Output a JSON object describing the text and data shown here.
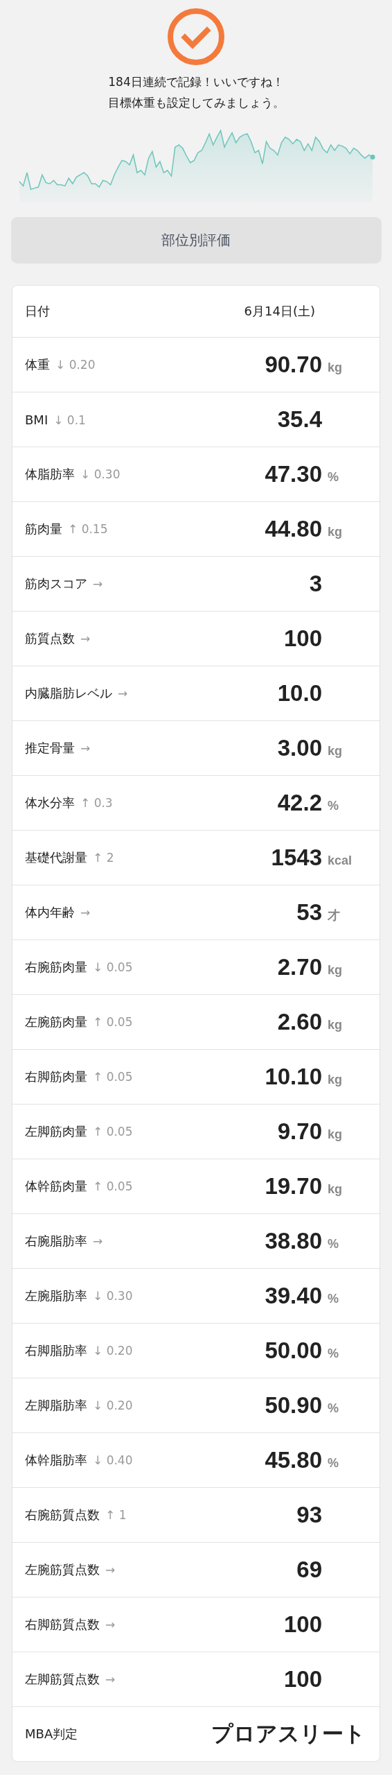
{
  "status": {
    "message_lines": [
      "184日連続で記録！いいですね！",
      "目標体重も設定してみましょう。"
    ]
  },
  "section_button": {
    "label": "部位別評価"
  },
  "table": {
    "rows": [
      {
        "kind": "date",
        "label": "日付",
        "value": "6月14日(土)"
      },
      {
        "kind": "number",
        "label": "体重",
        "change": "↓ 0.20",
        "value": "90.70",
        "unit": "kg"
      },
      {
        "kind": "number",
        "label": "BMI",
        "change": "↓ 0.1",
        "value": "35.4"
      },
      {
        "kind": "number",
        "label": "体脂肪率",
        "change": "↓ 0.30",
        "value": "47.30",
        "unit": "%"
      },
      {
        "kind": "number",
        "label": "筋肉量",
        "change": "↑ 0.15",
        "value": "44.80",
        "unit": "kg"
      },
      {
        "kind": "number",
        "label": "筋肉スコア",
        "change": "→",
        "value": "3"
      },
      {
        "kind": "number",
        "label": "筋質点数",
        "change": "→",
        "value": "100"
      },
      {
        "kind": "number",
        "label": "内臓脂肪レベル",
        "change": "→",
        "value": "10.0"
      },
      {
        "kind": "number",
        "label": "推定骨量",
        "change": "→",
        "value": "3.00",
        "unit": "kg"
      },
      {
        "kind": "number",
        "label": "体水分率",
        "change": "↑ 0.3",
        "value": "42.2",
        "unit": "%"
      },
      {
        "kind": "number",
        "label": "基礎代謝量",
        "change": "↑ 2",
        "value": "1543",
        "unit": "kcal"
      },
      {
        "kind": "number",
        "label": "体内年齢",
        "change": "→",
        "value": "53",
        "unit": "才"
      },
      {
        "kind": "number",
        "label": "右腕筋肉量",
        "change": "↓ 0.05",
        "value": "2.70",
        "unit": "kg"
      },
      {
        "kind": "number",
        "label": "左腕筋肉量",
        "change": "↑ 0.05",
        "value": "2.60",
        "unit": "kg"
      },
      {
        "kind": "number",
        "label": "右脚筋肉量",
        "change": "↑ 0.05",
        "value": "10.10",
        "unit": "kg"
      },
      {
        "kind": "number",
        "label": "左脚筋肉量",
        "change": "↑ 0.05",
        "value": "9.70",
        "unit": "kg"
      },
      {
        "kind": "number",
        "label": "体幹筋肉量",
        "change": "↑ 0.05",
        "value": "19.70",
        "unit": "kg"
      },
      {
        "kind": "number",
        "label": "右腕脂肪率",
        "change": "→",
        "value": "38.80",
        "unit": "%"
      },
      {
        "kind": "number",
        "label": "左腕脂肪率",
        "change": "↓ 0.30",
        "value": "39.40",
        "unit": "%"
      },
      {
        "kind": "number",
        "label": "右脚脂肪率",
        "change": "↓ 0.20",
        "value": "50.00",
        "unit": "%"
      },
      {
        "kind": "number",
        "label": "左脚脂肪率",
        "change": "↓ 0.20",
        "value": "50.90",
        "unit": "%"
      },
      {
        "kind": "number",
        "label": "体幹脂肪率",
        "change": "↓ 0.40",
        "value": "45.80",
        "unit": "%"
      },
      {
        "kind": "number",
        "label": "右腕筋質点数",
        "change": "↑ 1",
        "value": "93"
      },
      {
        "kind": "number",
        "label": "左腕筋質点数",
        "change": "→",
        "value": "69"
      },
      {
        "kind": "number",
        "label": "右脚筋質点数",
        "change": "→",
        "value": "100"
      },
      {
        "kind": "number",
        "label": "左脚筋質点数",
        "change": "→",
        "value": "100"
      },
      {
        "kind": "text",
        "label": "MBA判定",
        "value": "プロアスリート"
      }
    ]
  }
}
